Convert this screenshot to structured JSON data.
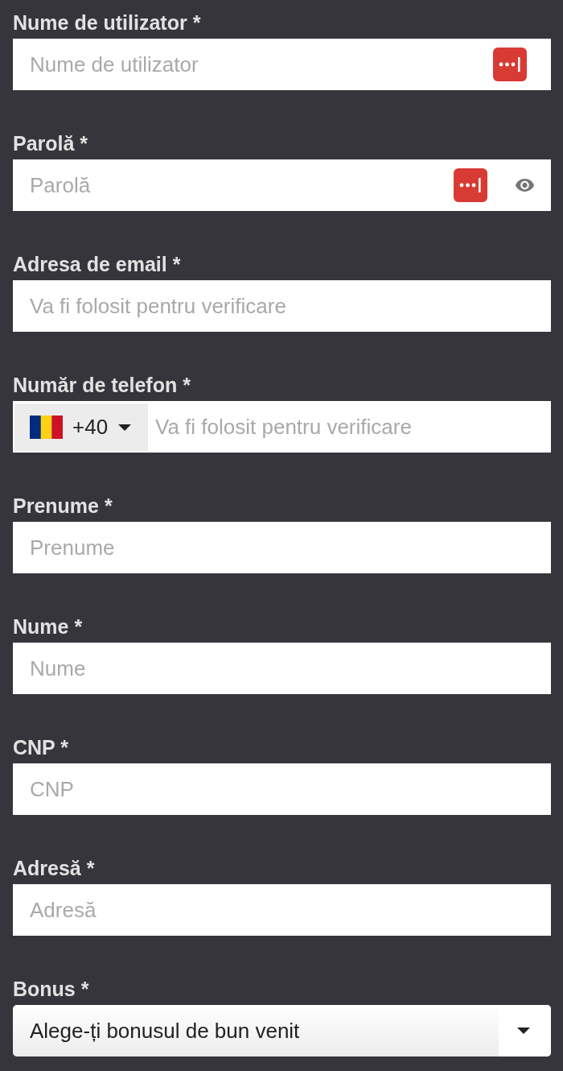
{
  "form": {
    "fields": [
      {
        "kind": "text",
        "label": "Nume de utilizator *",
        "placeholder": "Nume de utilizator",
        "autofill_icon": true
      },
      {
        "kind": "password",
        "label": "Parolă *",
        "placeholder": "Parolă",
        "autofill_icon": true
      },
      {
        "kind": "text",
        "label": "Adresa de email *",
        "placeholder": "Va fi folosit pentru verificare",
        "autofill_icon": false
      },
      {
        "kind": "phone",
        "label": "Număr de telefon *",
        "country_code": "+40",
        "placeholder": "Va fi folosit pentru verificare"
      },
      {
        "kind": "text",
        "label": "Prenume *",
        "placeholder": "Prenume",
        "autofill_icon": false
      },
      {
        "kind": "text",
        "label": "Nume *",
        "placeholder": "Nume",
        "autofill_icon": false
      },
      {
        "kind": "text",
        "label": "CNP *",
        "placeholder": "CNP",
        "autofill_icon": false
      },
      {
        "kind": "text",
        "label": "Adresă *",
        "placeholder": "Adresă",
        "autofill_icon": false
      },
      {
        "kind": "select",
        "label": "Bonus *",
        "value": "Alege-ți bonusul de bun venit"
      }
    ]
  }
}
